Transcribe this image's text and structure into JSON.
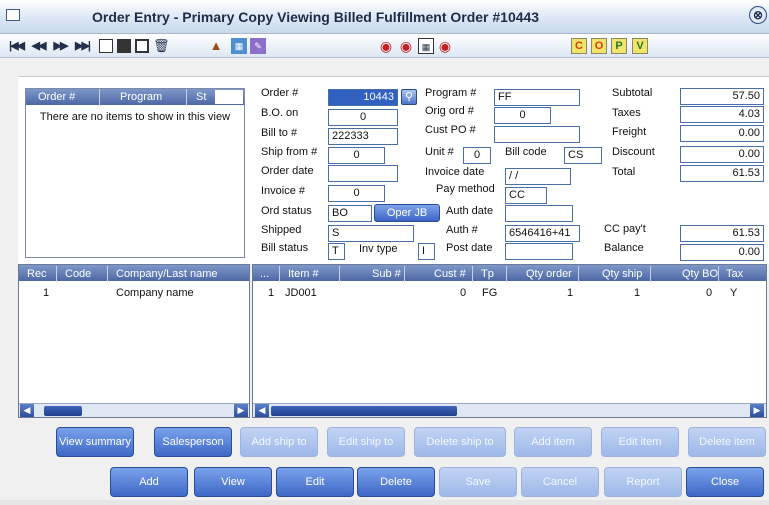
{
  "window": {
    "title": "Order Entry - Primary Copy Viewing Billed Fulfillment Order #10443"
  },
  "toolbar": {
    "nav_icons": [
      "first-icon",
      "prev-icon",
      "next-icon",
      "last-icon"
    ],
    "letters": {
      "c": "C",
      "o": "O",
      "p": "P",
      "v": "V"
    }
  },
  "orders_list": {
    "columns": [
      "Order #",
      "Program",
      "St"
    ],
    "empty_text": "There are no items to show in this view"
  },
  "form": {
    "order_no": {
      "label": "Order #",
      "value": "10443"
    },
    "bo_on": {
      "label": "B.O. on",
      "value": "0"
    },
    "bill_to": {
      "label": "Bill to #",
      "value": "222333"
    },
    "ship_from": {
      "label": "Ship from #",
      "value": "0"
    },
    "order_date": {
      "label": "Order date",
      "value": ""
    },
    "invoice_no": {
      "label": "Invoice #",
      "value": "0"
    },
    "ord_status": {
      "label": "Ord status",
      "value": "BO",
      "button": "Oper JB"
    },
    "shipped": {
      "label": "Shipped",
      "value": "S"
    },
    "bill_status": {
      "label": "Bill status",
      "value": "T"
    },
    "inv_type": {
      "label": "Inv type",
      "value": "I"
    },
    "program": {
      "label": "Program #",
      "value": "FF"
    },
    "orig_ord": {
      "label": "Orig ord #",
      "value": "0"
    },
    "cust_po": {
      "label": "Cust PO #",
      "value": ""
    },
    "unit": {
      "label": "Unit #",
      "value": "0"
    },
    "bill_code": {
      "label": "Bill code",
      "value": "CS"
    },
    "invoice_date": {
      "label": "Invoice date",
      "value": " / /"
    },
    "pay_method": {
      "label": "Pay method",
      "value": "CC"
    },
    "auth_date": {
      "label": "Auth date",
      "value": ""
    },
    "auth_no": {
      "label": "Auth #",
      "value": "6546416+41"
    },
    "post_date": {
      "label": "Post date",
      "value": ""
    },
    "subtotal": {
      "label": "Subtotal",
      "value": "57.50"
    },
    "taxes": {
      "label": "Taxes",
      "value": "4.03"
    },
    "freight": {
      "label": "Freight",
      "value": "0.00"
    },
    "discount": {
      "label": "Discount",
      "value": "0.00"
    },
    "total": {
      "label": "Total",
      "value": "61.53"
    },
    "cc_payt": {
      "label": "CC pay't",
      "value": "61.53"
    },
    "balance": {
      "label": "Balance",
      "value": "0.00"
    }
  },
  "customer_grid": {
    "columns": [
      "Rec",
      "Code",
      "Company/Last name"
    ],
    "rows": [
      {
        "rec": "1",
        "code": "",
        "name": "Company name"
      }
    ]
  },
  "items_grid": {
    "columns": [
      "...",
      "Item #",
      "Sub #",
      "Cust #",
      "Tp",
      "Qty order",
      "Qty ship",
      "Qty BO",
      "Tax"
    ],
    "rows": [
      {
        "n": "1",
        "item": "JD001",
        "sub": "",
        "cust": "0",
        "tp": "FG",
        "qty_order": "1",
        "qty_ship": "1",
        "qty_bo": "0",
        "tax": "Y"
      }
    ]
  },
  "buttons_row1": {
    "view_summary": "View summary",
    "salesperson": "Salesperson",
    "add_ship_to": "Add ship to",
    "edit_ship_to": "Edit ship to",
    "delete_ship_to": "Delete ship to",
    "add_item": "Add item",
    "edit_item": "Edit item",
    "delete_item": "Delete item"
  },
  "buttons_row2": {
    "add": "Add",
    "view": "View",
    "edit": "Edit",
    "delete": "Delete",
    "save": "Save",
    "cancel": "Cancel",
    "report": "Report",
    "close": "Close"
  }
}
